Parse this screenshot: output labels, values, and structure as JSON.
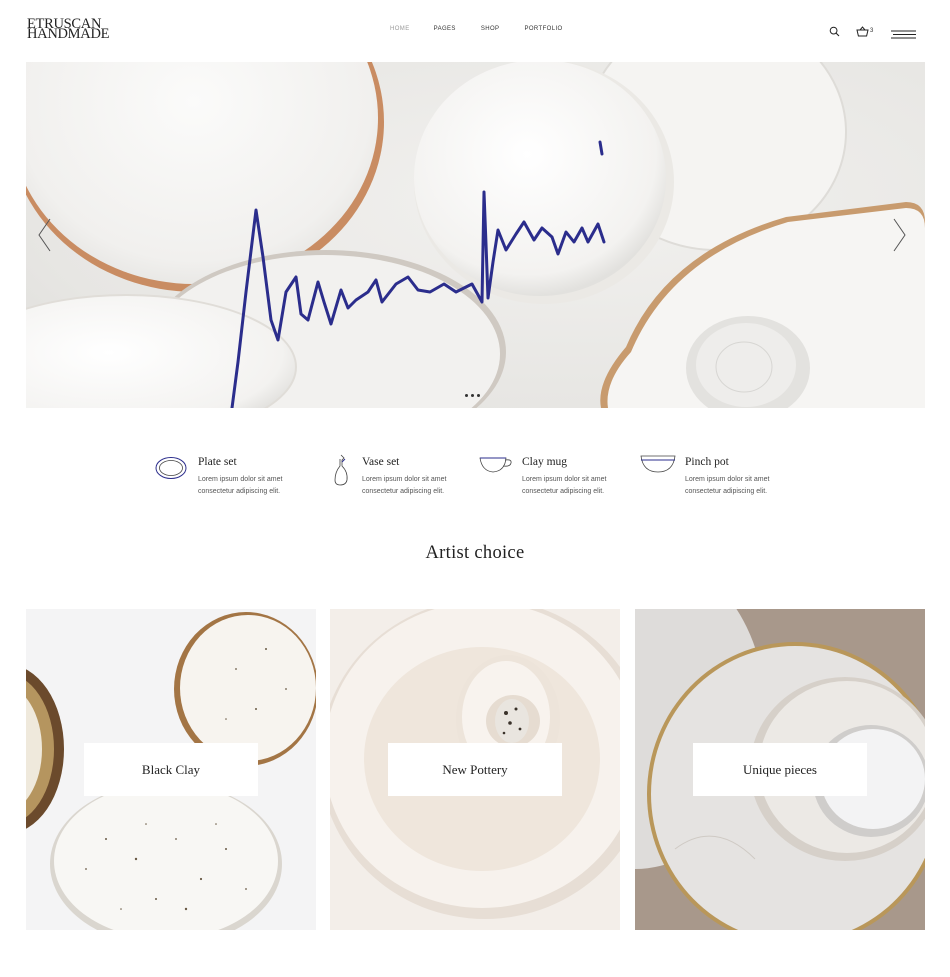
{
  "header": {
    "logo_line1": "ETRUSCAN",
    "logo_line2": "HANDMADE",
    "nav": [
      {
        "label": "HOME",
        "active": true
      },
      {
        "label": "PAGES"
      },
      {
        "label": "SHOP"
      },
      {
        "label": "PORTFOLIO"
      }
    ],
    "search_icon": "search-icon",
    "cart_icon": "basket-icon",
    "cart_count": "3",
    "menu_icon": "hamburger-icon"
  },
  "hero": {
    "signature": "handwritten signature",
    "slide_count": 3,
    "prev_icon": "chevron-left-icon",
    "next_icon": "chevron-right-icon",
    "signature_color": "#2b2d8c"
  },
  "features": [
    {
      "icon": "plate-icon",
      "title": "Plate set",
      "desc1": "Lorem ipsum dolor sit amet",
      "desc2": "consectetur adipiscing elit."
    },
    {
      "icon": "vase-icon",
      "title": "Vase set",
      "desc1": "Lorem ipsum dolor sit amet",
      "desc2": "consectetur adipiscing elit."
    },
    {
      "icon": "mug-icon",
      "title": "Clay mug",
      "desc1": "Lorem ipsum dolor sit amet",
      "desc2": "consectetur adipiscing elit."
    },
    {
      "icon": "bowl-icon",
      "title": "Pinch pot",
      "desc1": "Lorem ipsum dolor sit amet",
      "desc2": "consectetur adipiscing elit."
    }
  ],
  "section_title": "Artist choice",
  "cards": [
    {
      "label": "Black Clay"
    },
    {
      "label": "New Pottery"
    },
    {
      "label": "Unique pieces"
    }
  ],
  "accent_color": "#2b2d8c"
}
